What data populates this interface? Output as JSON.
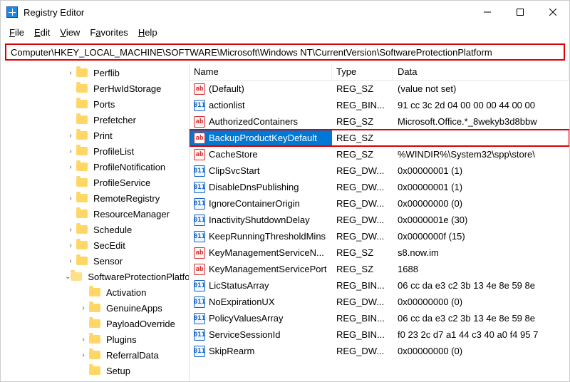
{
  "window": {
    "title": "Registry Editor"
  },
  "menu": {
    "file": "File",
    "edit": "Edit",
    "view": "View",
    "favorites": "Favorites",
    "help": "Help"
  },
  "address": "Computer\\HKEY_LOCAL_MACHINE\\SOFTWARE\\Microsoft\\Windows NT\\CurrentVersion\\SoftwareProtectionPlatform",
  "tree": [
    {
      "label": "Perflib",
      "depth": 1,
      "twisty": ">"
    },
    {
      "label": "PerHwIdStorage",
      "depth": 1,
      "twisty": ""
    },
    {
      "label": "Ports",
      "depth": 1,
      "twisty": ""
    },
    {
      "label": "Prefetcher",
      "depth": 1,
      "twisty": ""
    },
    {
      "label": "Print",
      "depth": 1,
      "twisty": ">"
    },
    {
      "label": "ProfileList",
      "depth": 1,
      "twisty": ">"
    },
    {
      "label": "ProfileNotification",
      "depth": 1,
      "twisty": ">"
    },
    {
      "label": "ProfileService",
      "depth": 1,
      "twisty": ""
    },
    {
      "label": "RemoteRegistry",
      "depth": 1,
      "twisty": ">"
    },
    {
      "label": "ResourceManager",
      "depth": 1,
      "twisty": ""
    },
    {
      "label": "Schedule",
      "depth": 1,
      "twisty": ">"
    },
    {
      "label": "SecEdit",
      "depth": 1,
      "twisty": ">"
    },
    {
      "label": "Sensor",
      "depth": 1,
      "twisty": ">"
    },
    {
      "label": "SoftwareProtectionPlatform",
      "depth": 1,
      "twisty": "v",
      "open": true
    },
    {
      "label": "Activation",
      "depth": 2,
      "twisty": ""
    },
    {
      "label": "GenuineApps",
      "depth": 2,
      "twisty": ">"
    },
    {
      "label": "PayloadOverride",
      "depth": 2,
      "twisty": ""
    },
    {
      "label": "Plugins",
      "depth": 2,
      "twisty": ">"
    },
    {
      "label": "ReferralData",
      "depth": 2,
      "twisty": ">"
    },
    {
      "label": "Setup",
      "depth": 2,
      "twisty": ""
    }
  ],
  "columns": {
    "name": "Name",
    "type": "Type",
    "data": "Data"
  },
  "values": [
    {
      "icon": "str",
      "name": "(Default)",
      "type": "REG_SZ",
      "data": "(value not set)"
    },
    {
      "icon": "bin",
      "name": "actionlist",
      "type": "REG_BIN...",
      "data": "91 cc 3c 2d 04 00 00 00 44 00 00"
    },
    {
      "icon": "str",
      "name": "AuthorizedContainers",
      "type": "REG_SZ",
      "data": "Microsoft.Office.*_8wekyb3d8bbw"
    },
    {
      "icon": "str",
      "name": "BackupProductKeyDefault",
      "type": "REG_SZ",
      "data": "",
      "selected": true,
      "highlight": true
    },
    {
      "icon": "str",
      "name": "CacheStore",
      "type": "REG_SZ",
      "data": "%WINDIR%\\System32\\spp\\store\\"
    },
    {
      "icon": "bin",
      "name": "ClipSvcStart",
      "type": "REG_DW...",
      "data": "0x00000001 (1)"
    },
    {
      "icon": "bin",
      "name": "DisableDnsPublishing",
      "type": "REG_DW...",
      "data": "0x00000001 (1)"
    },
    {
      "icon": "bin",
      "name": "IgnoreContainerOrigin",
      "type": "REG_DW...",
      "data": "0x00000000 (0)"
    },
    {
      "icon": "bin",
      "name": "InactivityShutdownDelay",
      "type": "REG_DW...",
      "data": "0x0000001e (30)"
    },
    {
      "icon": "bin",
      "name": "KeepRunningThresholdMins",
      "type": "REG_DW...",
      "data": "0x0000000f (15)"
    },
    {
      "icon": "str",
      "name": "KeyManagementServiceN...",
      "type": "REG_SZ",
      "data": "s8.now.im"
    },
    {
      "icon": "str",
      "name": "KeyManagementServicePort",
      "type": "REG_SZ",
      "data": "1688"
    },
    {
      "icon": "bin",
      "name": "LicStatusArray",
      "type": "REG_BIN...",
      "data": "06 cc da e3 c2 3b 13 4e 8e 59 8e"
    },
    {
      "icon": "bin",
      "name": "NoExpirationUX",
      "type": "REG_DW...",
      "data": "0x00000000 (0)"
    },
    {
      "icon": "bin",
      "name": "PolicyValuesArray",
      "type": "REG_BIN...",
      "data": "06 cc da e3 c2 3b 13 4e 8e 59 8e"
    },
    {
      "icon": "bin",
      "name": "ServiceSessionId",
      "type": "REG_BIN...",
      "data": "f0 23 2c d7 a1 44 c3 40 a0 f4 95 7"
    },
    {
      "icon": "bin",
      "name": "SkipRearm",
      "type": "REG_DW...",
      "data": "0x00000000 (0)"
    }
  ],
  "icons": {
    "str_glyph": "ab",
    "bin_glyph": "011"
  }
}
